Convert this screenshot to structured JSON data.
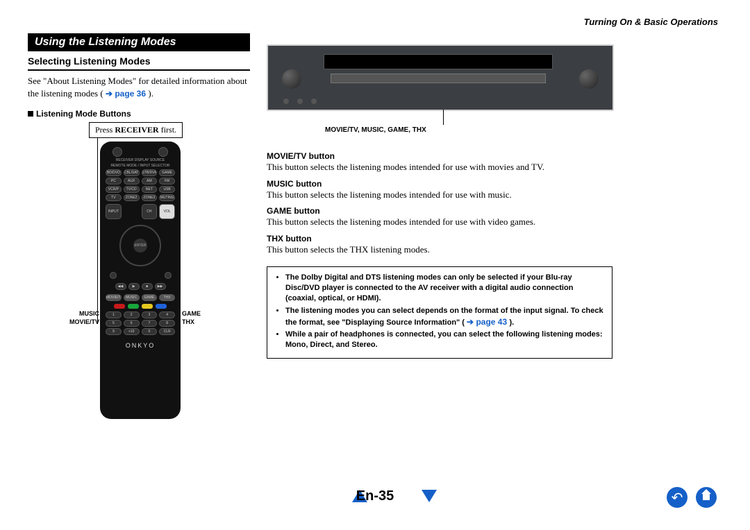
{
  "header": {
    "breadcrumb": "Turning On & Basic Operations"
  },
  "section_title": "Using the Listening Modes",
  "left": {
    "subhead": "Selecting Listening Modes",
    "intro_a": "See \"About Listening Modes\" for detailed information about the listening modes (",
    "intro_link_arrow": "➔",
    "intro_link": "page 36",
    "intro_b": ").",
    "mini_head": "Listening Mode Buttons",
    "callout_a": "Press ",
    "callout_b": "RECEIVER",
    "callout_c": " first.",
    "side_labels": {
      "music": "MUSIC",
      "movietv": "MOVIE/TV",
      "game": "GAME",
      "thx": "THX"
    },
    "remote": {
      "toprow": "RECEIVER   DISPLAY   SOURCE",
      "grid1": [
        "BD/DVD",
        "CBL/SAT",
        "STB/DVR",
        "GAME"
      ],
      "grid2": [
        "PC",
        "AUX",
        "AM",
        "FM"
      ],
      "grid3": [
        "VCR/P",
        "TV/CD",
        "NET",
        "USB"
      ],
      "grid4": [
        "TV",
        "ZONE2",
        "ZONE3",
        "MUTING"
      ],
      "row_iv": [
        "INPUT",
        "",
        "CH",
        "VOL"
      ],
      "enter": "ENTER",
      "mode_row": [
        "MOVIE/TV",
        "MUSIC",
        "GAME",
        "THX"
      ],
      "num_row1": [
        "1",
        "2",
        "3",
        "4"
      ],
      "num_row2": [
        "5",
        "6",
        "7",
        "8"
      ],
      "num_row3": [
        "9",
        "+10",
        "0",
        "CLR"
      ],
      "brand": "ONKYO"
    }
  },
  "right": {
    "receiver_caption": "MOVIE/TV, MUSIC, GAME, THX",
    "items": [
      {
        "h": "MOVIE/TV button",
        "t": "This button selects the listening modes intended for use with movies and TV."
      },
      {
        "h": "MUSIC button",
        "t": "This button selects the listening modes intended for use with music."
      },
      {
        "h": "GAME button",
        "t": "This button selects the listening modes intended for use with video games."
      },
      {
        "h": "THX button",
        "t": "This button selects the THX listening modes."
      }
    ],
    "notes": {
      "n1": "The Dolby Digital and DTS listening modes can only be selected if your Blu-ray Disc/DVD player is connected to the AV receiver with a digital audio connection (coaxial, optical, or HDMI).",
      "n2a": "The listening modes you can select depends on the format of the input signal. To check the format, see \"Displaying Source Information\" (",
      "n2_link_arrow": "➔",
      "n2_link": "page 43",
      "n2b": ").",
      "n3": "While a pair of headphones is connected, you can select the following listening modes: Mono, Direct, and Stereo."
    }
  },
  "footer": {
    "page": "En-35"
  }
}
